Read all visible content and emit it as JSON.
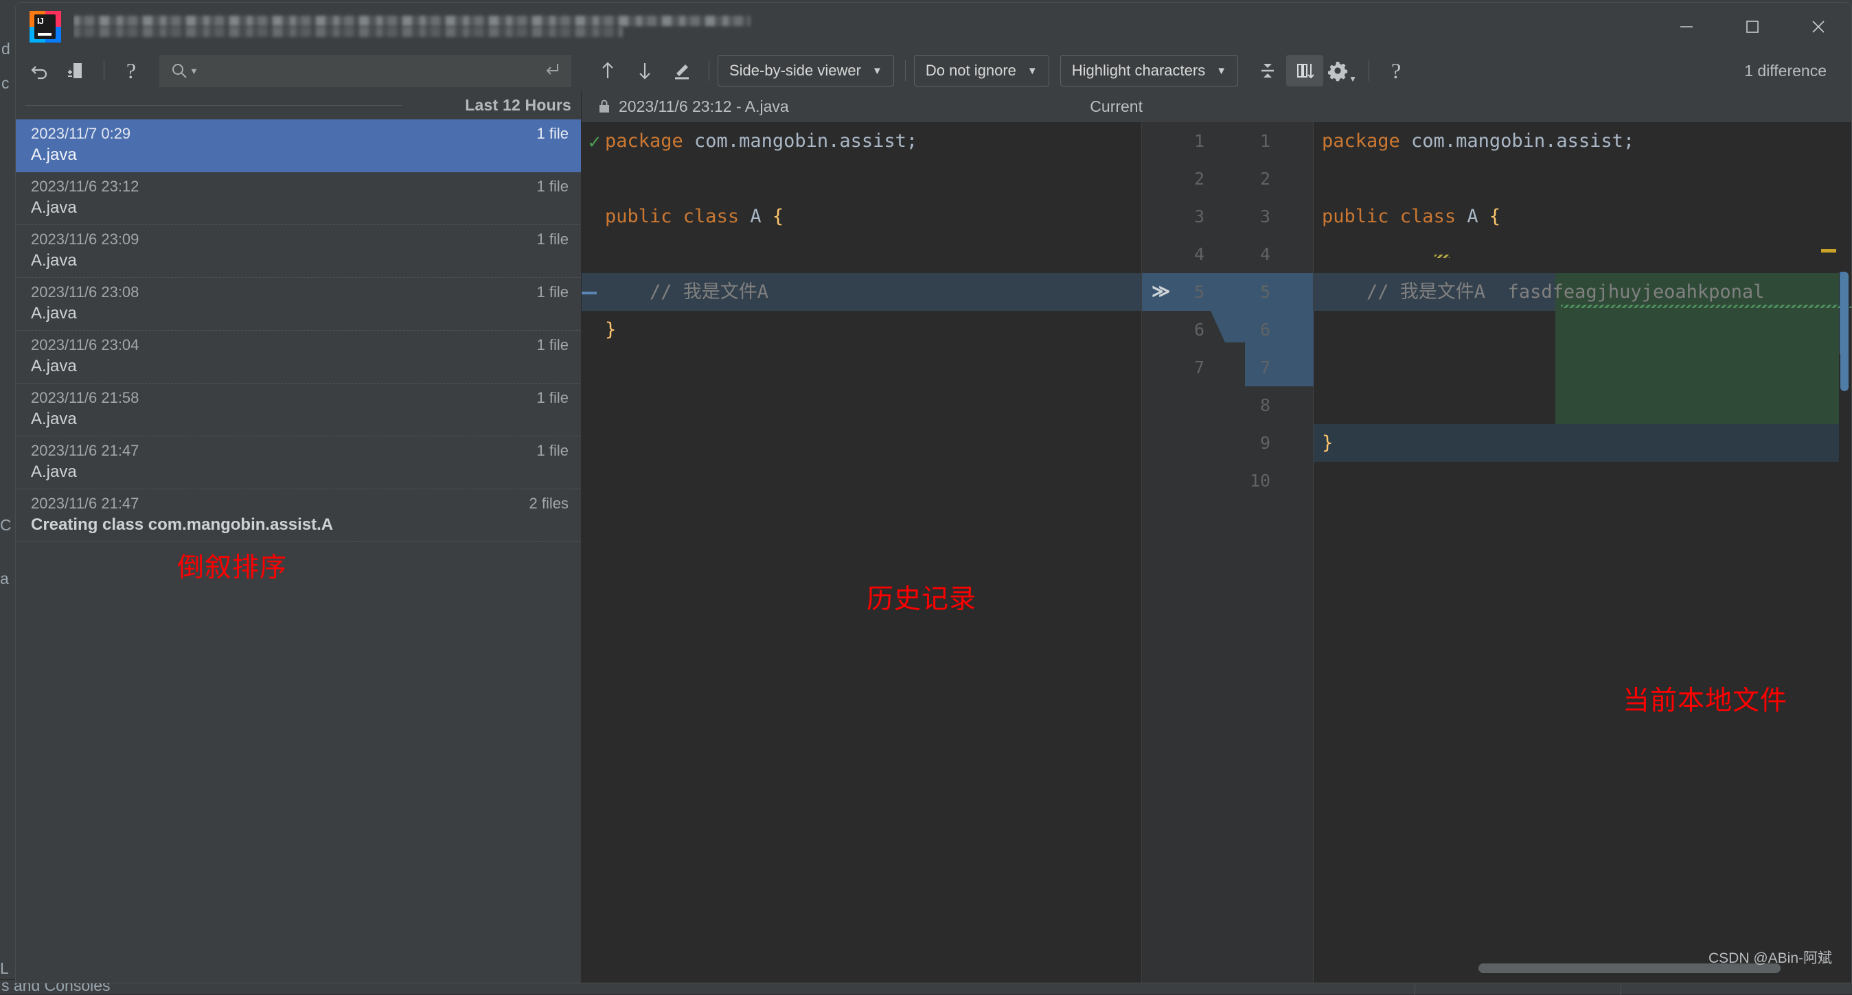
{
  "window": {
    "app_icon": "intellij-idea-icon",
    "title_obscured": true,
    "controls": {
      "minimize": "─",
      "maximize": "☐",
      "close": "✕"
    }
  },
  "background": {
    "ghost_text_left": "d",
    "ghost_text_left2": "c",
    "ghost_bottom": "s and Consoles",
    "ghost_mid_left": "a",
    "ghost_c": "C",
    "ghost_l": "L"
  },
  "toolbar": {
    "undo_icon": "undo-icon",
    "revert_icon": "revert-selection-icon",
    "help_icon": "?",
    "search": {
      "placeholder": "",
      "value": "",
      "icon": "search-icon",
      "submit_icon": "enter-key-icon"
    },
    "prev_diff_icon": "arrow-up-icon",
    "next_diff_icon": "arrow-down-icon",
    "edit_icon": "edit-pencil-icon",
    "viewer_mode": "Side-by-side viewer",
    "whitespace_mode": "Do not ignore",
    "highlight_mode": "Highlight characters",
    "collapse_icon": "collapse-unchanged-icon",
    "columns_icon": "synchronize-scroll-icon",
    "settings_icon": "gear-icon",
    "help2_icon": "question-mark-icon",
    "caret": "▼",
    "difference_count": "1 difference"
  },
  "history": {
    "group_label": "Last 12 Hours",
    "items": [
      {
        "date": "2023/11/7 0:29",
        "file": "A.java",
        "count": "1 file",
        "selected": true,
        "bold": false
      },
      {
        "date": "2023/11/6 23:12",
        "file": "A.java",
        "count": "1 file",
        "selected": false,
        "bold": false
      },
      {
        "date": "2023/11/6 23:09",
        "file": "A.java",
        "count": "1 file",
        "selected": false,
        "bold": false
      },
      {
        "date": "2023/11/6 23:08",
        "file": "A.java",
        "count": "1 file",
        "selected": false,
        "bold": false
      },
      {
        "date": "2023/11/6 23:04",
        "file": "A.java",
        "count": "1 file",
        "selected": false,
        "bold": false
      },
      {
        "date": "2023/11/6 21:58",
        "file": "A.java",
        "count": "1 file",
        "selected": false,
        "bold": false
      },
      {
        "date": "2023/11/6 21:47",
        "file": "A.java",
        "count": "1 file",
        "selected": false,
        "bold": false
      },
      {
        "date": "2023/11/6 21:47",
        "file": "Creating class com.mangobin.assist.A",
        "count": "2 files",
        "selected": false,
        "bold": true
      }
    ],
    "annotation": "倒叙排序"
  },
  "diff": {
    "lock_icon": "lock-icon",
    "left_title": "2023/11/6 23:12 - A.java",
    "right_title": "Current",
    "valid_icon": "checkmark-icon",
    "annotation_history": "历史记录",
    "annotation_current": "当前本地文件",
    "left_lines": [
      {
        "n": 1,
        "tokens": [
          {
            "t": "package ",
            "c": "kw"
          },
          {
            "t": "com.mangobin.assist;",
            "c": "cls"
          }
        ]
      },
      {
        "n": 2,
        "tokens": []
      },
      {
        "n": 3,
        "tokens": [
          {
            "t": "public ",
            "c": "kw"
          },
          {
            "t": "class ",
            "c": "kw"
          },
          {
            "t": "A ",
            "c": "typ"
          },
          {
            "t": "{",
            "c": "brc"
          }
        ]
      },
      {
        "n": 4,
        "tokens": []
      },
      {
        "n": 5,
        "tokens": [
          {
            "t": "    // 我是文件A",
            "c": "cmt"
          }
        ],
        "changed": true
      },
      {
        "n": 6,
        "tokens": [
          {
            "t": "}",
            "c": "brc"
          }
        ]
      }
    ],
    "right_lines": [
      {
        "n": 1,
        "tokens": [
          {
            "t": "package ",
            "c": "kw"
          },
          {
            "t": "com.mangobin.assist;",
            "c": "cls"
          }
        ]
      },
      {
        "n": 2,
        "tokens": []
      },
      {
        "n": 3,
        "tokens": [
          {
            "t": "public ",
            "c": "kw"
          },
          {
            "t": "class ",
            "c": "kw"
          },
          {
            "t": "A ",
            "c": "typ"
          },
          {
            "t": "{",
            "c": "brc"
          }
        ]
      },
      {
        "n": 4,
        "tokens": []
      },
      {
        "n": 5,
        "tokens": [
          {
            "t": "    // 我是文件A",
            "c": "cmt"
          },
          {
            "t": "  fasdfeagjhuyjeoahkponal",
            "c": "cmt"
          }
        ],
        "added": true
      },
      {
        "n": 6,
        "tokens": []
      },
      {
        "n": 7,
        "tokens": []
      },
      {
        "n": 8,
        "tokens": []
      },
      {
        "n": 9,
        "tokens": [
          {
            "t": "}",
            "c": "brc"
          }
        ]
      },
      {
        "n": 10,
        "tokens": []
      }
    ],
    "gutter_old": [
      "1",
      "2",
      "3",
      "4",
      "5",
      "6",
      "7"
    ],
    "gutter_new": [
      "1",
      "2",
      "3",
      "4",
      "5",
      "6",
      "7",
      "8",
      "9",
      "10"
    ],
    "chevron_marker": "≫"
  },
  "watermark": "CSDN @ABin-阿斌",
  "colors": {
    "accent_selected": "#4b6eaf",
    "added_bg": "#2f4a36",
    "changed_bg": "#33404d",
    "annotation_red": "#ff0000",
    "panel_bg": "#3c3f41",
    "editor_bg": "#2b2b2b"
  }
}
